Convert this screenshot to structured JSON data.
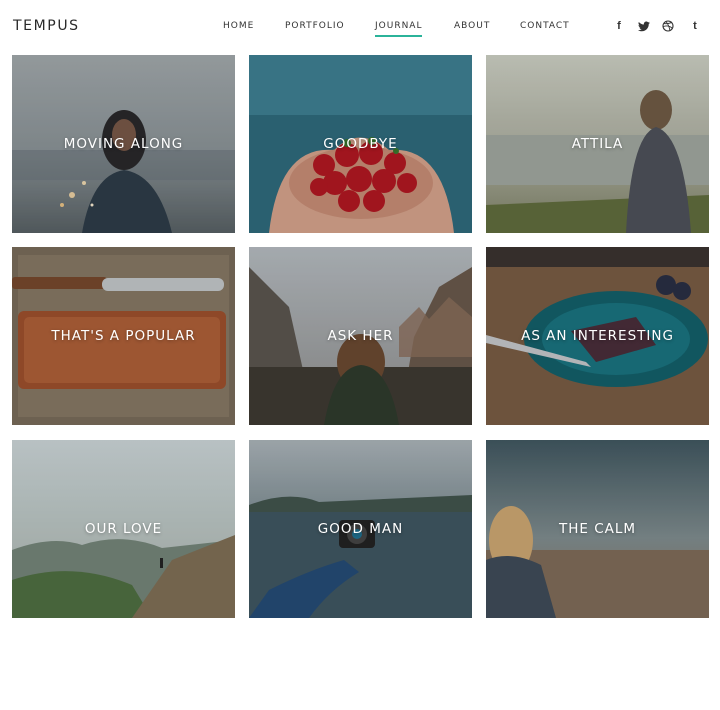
{
  "site": {
    "logo": "TEMPUS"
  },
  "accent": "#2bb39a",
  "nav": {
    "items": [
      {
        "label": "HOME",
        "active": false
      },
      {
        "label": "PORTFOLIO",
        "active": false
      },
      {
        "label": "JOURNAL",
        "active": true
      },
      {
        "label": "ABOUT",
        "active": false
      },
      {
        "label": "CONTACT",
        "active": false
      }
    ]
  },
  "social": [
    {
      "icon": "facebook-icon",
      "glyph": "f"
    },
    {
      "icon": "twitter-icon",
      "glyph": "🐦"
    },
    {
      "icon": "dribbble-icon",
      "glyph": "◎"
    },
    {
      "icon": "tumblr-icon",
      "glyph": "t"
    }
  ],
  "posts": [
    {
      "title": "MOVING ALONG"
    },
    {
      "title": "GOODBYE"
    },
    {
      "title": "ATTILA"
    },
    {
      "title": "THAT'S A POPULAR"
    },
    {
      "title": "ASK HER"
    },
    {
      "title": "AS AN INTERESTING"
    },
    {
      "title": "OUR LOVE"
    },
    {
      "title": "GOOD MAN"
    },
    {
      "title": "THE CALM"
    }
  ]
}
